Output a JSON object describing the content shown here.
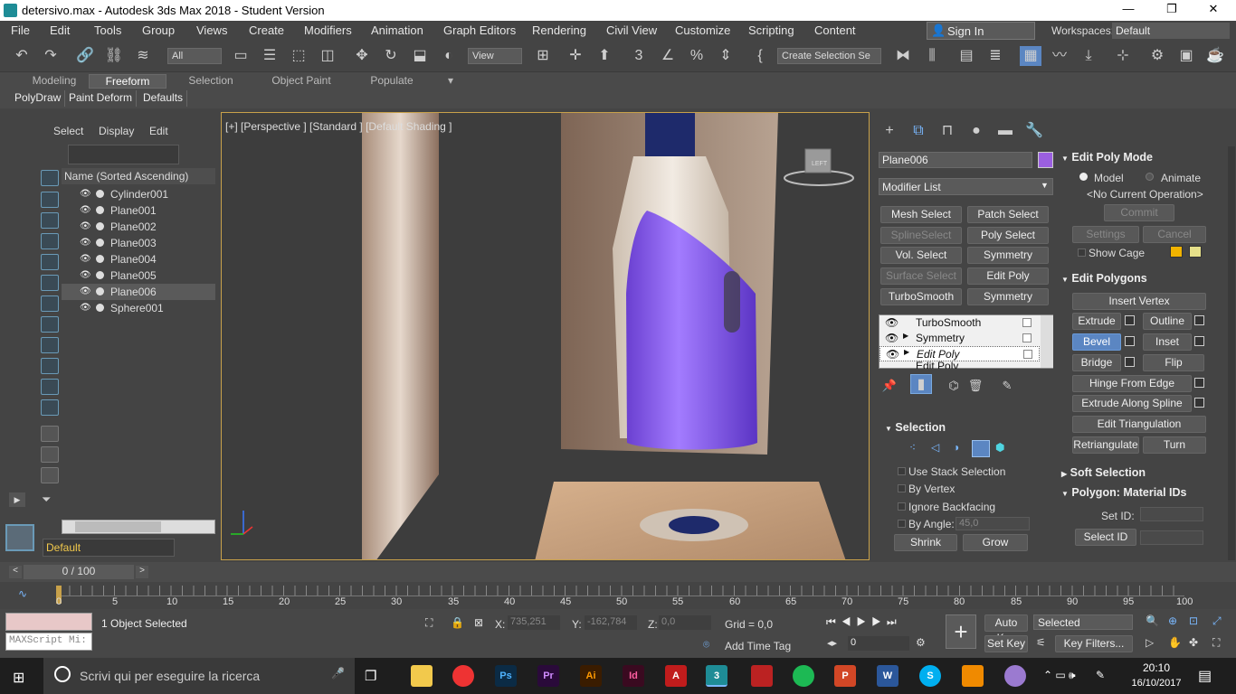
{
  "window": {
    "title": "detersivo.max - Autodesk 3ds Max 2018 - Student Version",
    "minimize": "—",
    "maximize": "❐",
    "close": "✕"
  },
  "menu": [
    "File",
    "Edit",
    "Tools",
    "Group",
    "Views",
    "Create",
    "Modifiers",
    "Animation",
    "Graph Editors",
    "Rendering",
    "Civil View",
    "Customize",
    "Scripting",
    "Content"
  ],
  "signin": "Sign In",
  "workspaces": {
    "label": "Workspaces:",
    "value": "Default"
  },
  "toolbar": {
    "filter": "All",
    "refcoord": "View",
    "selset": "Create Selection Se"
  },
  "ribbon": {
    "tabs": [
      "Modeling",
      "Freeform",
      "Selection",
      "Object Paint",
      "Populate"
    ],
    "buttons": [
      "PolyDraw",
      "Paint Deform",
      "Defaults"
    ]
  },
  "scene": {
    "tabs": [
      "Select",
      "Display",
      "Edit"
    ],
    "column": "Name (Sorted Ascending)",
    "objects": [
      "Cylinder001",
      "Plane001",
      "Plane002",
      "Plane003",
      "Plane004",
      "Plane005",
      "Plane006",
      "Sphere001"
    ],
    "selected": "Plane006",
    "layer": "Default"
  },
  "viewport": {
    "label": "[+] [Perspective ] [Standard ] [Default Shading ]",
    "cube": "LEFT"
  },
  "cmd": {
    "objname": "Plane006",
    "objcolor": "#9b5fe0",
    "modlist": "Modifier List",
    "buttons": [
      "Mesh Select",
      "Patch Select",
      "SplineSelect",
      "Poly Select",
      "Vol. Select",
      "Symmetry",
      "Surface Select",
      "Edit Poly",
      "TurboSmooth",
      "Symmetry"
    ],
    "stack": [
      "TurboSmooth",
      "Symmetry",
      "Edit Poly",
      "Edit Poly"
    ],
    "selection": {
      "title": "Selection",
      "use_stack": "Use Stack Selection",
      "by_vertex": "By Vertex",
      "ignore_back": "Ignore Backfacing",
      "by_angle": "By Angle:",
      "angle": "45,0",
      "shrink": "Shrink",
      "grow": "Grow"
    }
  },
  "editpoly": {
    "mode_title": "Edit Poly Mode",
    "model": "Model",
    "animate": "Animate",
    "noop": "<No Current Operation>",
    "commit": "Commit",
    "settings": "Settings",
    "cancel": "Cancel",
    "show_cage": "Show Cage",
    "polygons_title": "Edit Polygons",
    "insert_vertex": "Insert Vertex",
    "extrude": "Extrude",
    "outline": "Outline",
    "bevel": "Bevel",
    "inset": "Inset",
    "bridge": "Bridge",
    "flip": "Flip",
    "hinge": "Hinge From Edge",
    "extrude_spline": "Extrude Along Spline",
    "edit_tri": "Edit Triangulation",
    "retri": "Retriangulate",
    "turn": "Turn",
    "soft": "Soft Selection",
    "matids": "Polygon: Material IDs",
    "setid": "Set ID:",
    "selectid": "Select ID"
  },
  "time": {
    "slider": "0 / 100",
    "ticks": [
      "0",
      "5",
      "10",
      "15",
      "20",
      "25",
      "30",
      "35",
      "40",
      "45",
      "50",
      "55",
      "60",
      "65",
      "70",
      "75",
      "80",
      "85",
      "90",
      "95",
      "100"
    ]
  },
  "status": {
    "selected": "1 Object Selected",
    "x_label": "X:",
    "x": "735,251",
    "y_label": "Y:",
    "y": "-162,784",
    "z_label": "Z:",
    "z": "0,0",
    "grid": "Grid = 0,0",
    "autokey": "Auto Key",
    "setkey": "Set Key",
    "keymode": "Selected",
    "keyfilters": "Key Filters...",
    "frame": "0",
    "addtimetag": "Add Time Tag",
    "maxscript": "MAXScript Mi:"
  },
  "taskbar": {
    "search": "Scrivi qui per eseguire la ricerca",
    "time": "20:10",
    "date": "16/10/2017"
  }
}
